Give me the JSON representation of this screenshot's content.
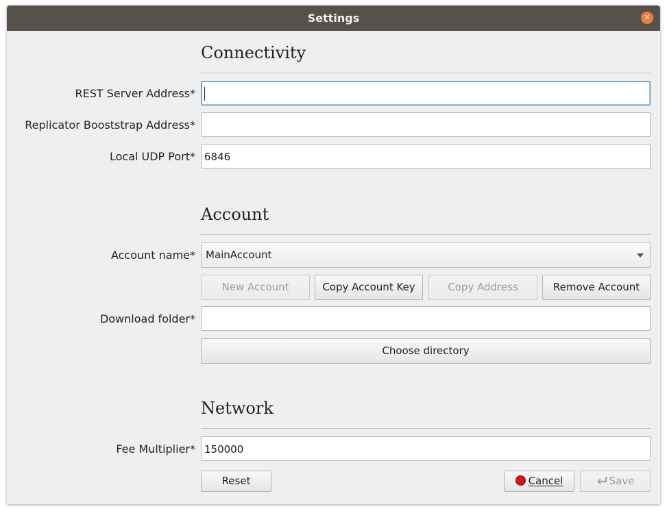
{
  "window": {
    "title": "Settings"
  },
  "sections": {
    "connectivity": "Connectivity",
    "account": "Account",
    "network": "Network"
  },
  "fields": {
    "rest_server": {
      "label": "REST Server Address*",
      "value": ""
    },
    "replicator": {
      "label": "Replicator Booststrap Address*",
      "value": ""
    },
    "udp_port": {
      "label": "Local UDP Port*",
      "value": "6846"
    },
    "account_name": {
      "label": "Account name*",
      "value": "MainAccount"
    },
    "download_folder": {
      "label": "Download folder*",
      "value": ""
    },
    "fee_multiplier": {
      "label": "Fee Multiplier*",
      "value": "150000"
    }
  },
  "buttons": {
    "new_account": "New Account",
    "copy_key": "Copy Account Key",
    "copy_address": "Copy Address",
    "remove_account": "Remove Account",
    "choose_dir": "Choose directory",
    "reset": "Reset",
    "cancel": "Cancel",
    "save": "Save"
  },
  "colors": {
    "titlebar": "#57514b",
    "close": "#ef7b3e",
    "cancel_icon": "#d9111b"
  },
  "icons": {
    "close": "close-icon",
    "cancel": "stop-icon",
    "save": "save-arrow-icon",
    "combo": "chevron-down-icon"
  }
}
